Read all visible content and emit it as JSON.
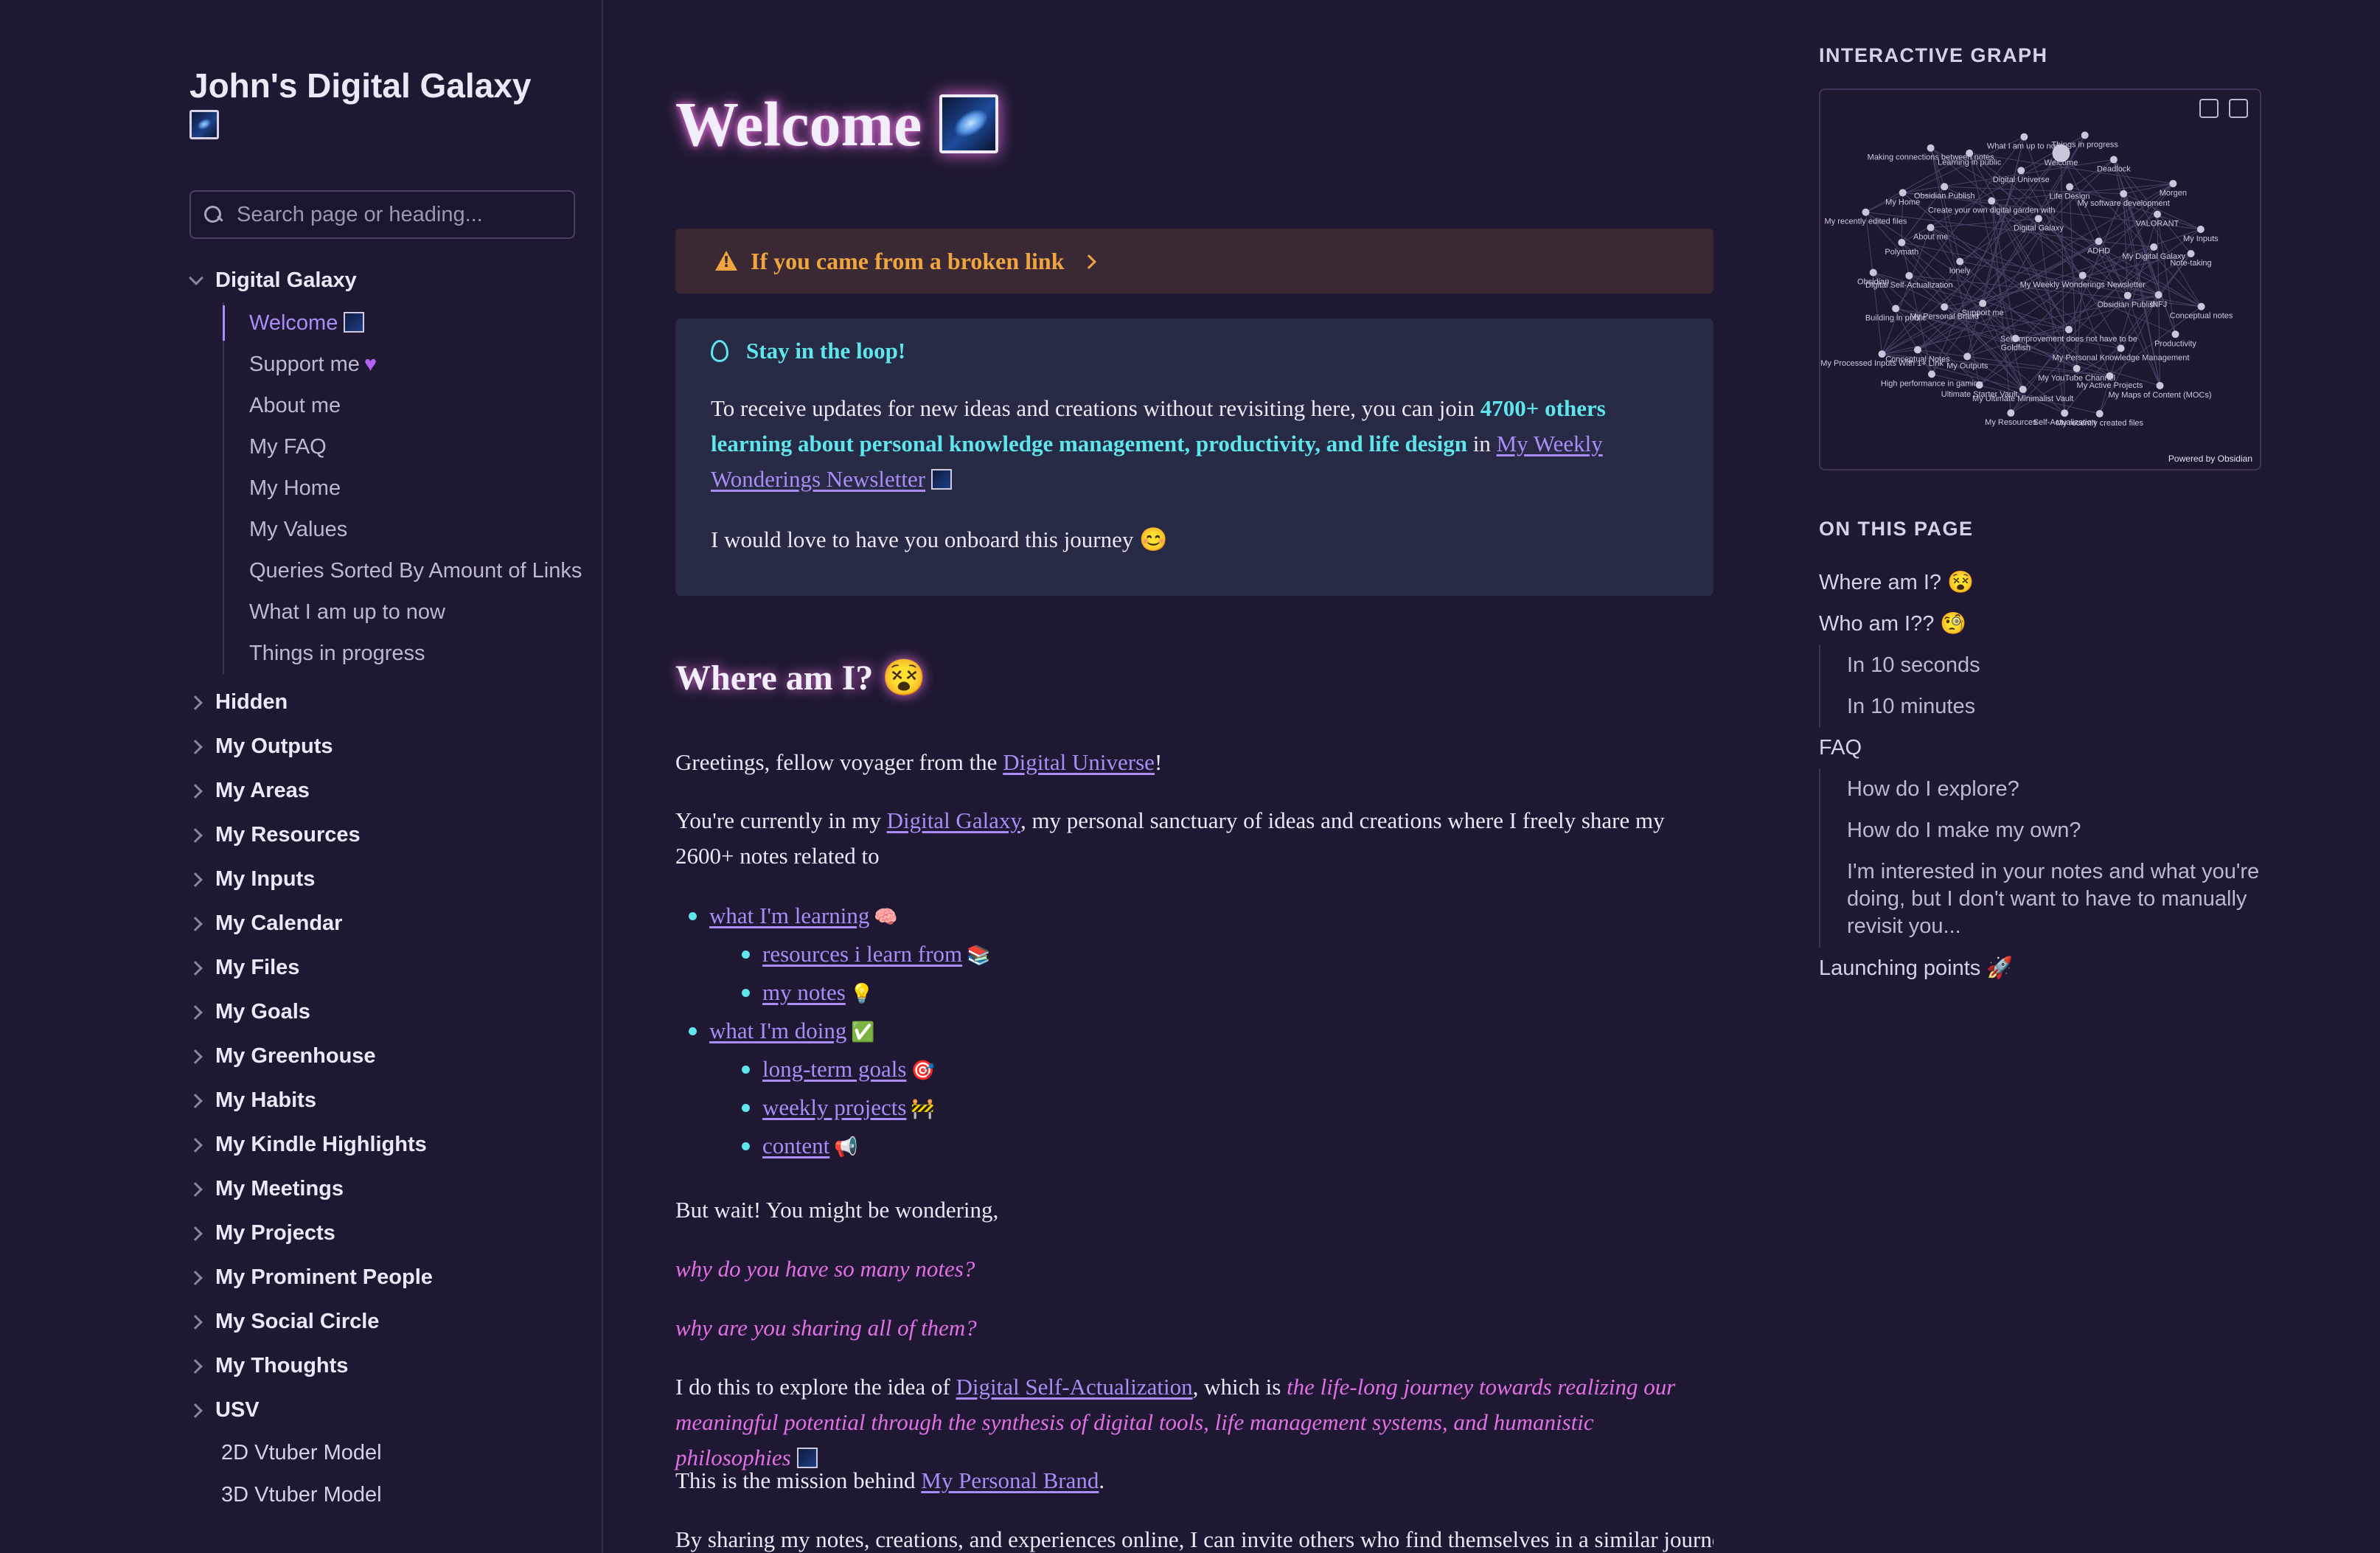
{
  "site": {
    "title": "John's Digital Galaxy",
    "search_placeholder": "Search page or heading..."
  },
  "nav": {
    "open_group": "Digital Galaxy",
    "children": [
      "Welcome",
      "Support me",
      "About me",
      "My FAQ",
      "My Home",
      "My Values",
      "Queries Sorted By Amount of Links",
      "What I am up to now",
      "Things in progress"
    ],
    "groups": [
      "Hidden",
      "My Outputs",
      "My Areas",
      "My Resources",
      "My Inputs",
      "My Calendar",
      "My Files",
      "My Goals",
      "My Greenhouse",
      "My Habits",
      "My Kindle Highlights",
      "My Meetings",
      "My Projects",
      "My Prominent People",
      "My Social Circle",
      "My Thoughts",
      "USV"
    ],
    "leaves": [
      "2D Vtuber Model",
      "3D Vtuber Model"
    ]
  },
  "main": {
    "title": "Welcome",
    "broken_link": "If you came from a broken link",
    "callout_title": "Stay in the loop!",
    "callout_p1_a": "To receive updates for new ideas and creations without revisiting here, you can join ",
    "callout_p1_b": "4700+ others learning about personal knowledge management, productivity, and life design",
    "callout_p1_c": " in ",
    "callout_p1_link": "My Weekly Wonderings Newsletter",
    "callout_p2": "I would love to have you onboard this journey 😊",
    "h2": "Where am I? 😵",
    "p1_a": "Greetings, fellow voyager from the ",
    "p1_link": "Digital Universe",
    "p1_b": "!",
    "p2_a": "You're currently in my ",
    "p2_link": "Digital Galaxy",
    "p2_b": ", my personal sanctuary of ideas and creations where I freely share my 2600+ notes related to",
    "bullets": [
      {
        "text": "what I'm learning",
        "emoji": "🧠",
        "sub": false
      },
      {
        "text": "resources i learn from",
        "emoji": "📚",
        "sub": true
      },
      {
        "text": "my notes",
        "emoji": "💡",
        "sub": true
      },
      {
        "text": "what I'm doing",
        "emoji": "✅",
        "sub": false
      },
      {
        "text": "long-term goals",
        "emoji": "🎯",
        "sub": true
      },
      {
        "text": "weekly projects",
        "emoji": "🚧",
        "sub": true
      },
      {
        "text": "content",
        "emoji": "📢",
        "sub": true
      }
    ],
    "p3": "But wait! You might be wondering,",
    "q1": "why do you have so many notes?",
    "q2": "why are you sharing all of them?",
    "p4_a": "I do this to explore the idea of ",
    "p4_link": "Digital Self-Actualization",
    "p4_b": ", which is ",
    "p4_italic": "the life-long journey towards realizing our meaningful potential through the synthesis of digital tools, life management systems, and humanistic philosophies",
    "p5_a": "This is the mission behind ",
    "p5_link": "My Personal Brand",
    "p5_b": ".",
    "p6": "By sharing my notes, creations, and experiences online, I can invite others who find themselves in a similar journey"
  },
  "right": {
    "graph_label": "INTERACTIVE GRAPH",
    "graph_nodes": [
      "My Weekly Wonderings Newsletter",
      "Support me",
      "Digital Galaxy",
      "Self-improvement does not have to be",
      "lonely",
      "ADHD",
      "Goldfish",
      "Create your own digital garden with",
      "Obsidian Publish",
      "My Personal Brand",
      "Life Design",
      "My YouTube Channel",
      "About me",
      "My Digital Galaxy",
      "My Outputs",
      "Digital Universe",
      "My Personal Knowledge Management",
      "Digital Self-Actualization",
      "My software development",
      "My Ultimate Minimalist Vault",
      "Obsidian Publish",
      "INFJ",
      "Conceptual Notes",
      "Welcome",
      "My Active Projects",
      "Polymath",
      "VALORANT",
      "Ultimate Starter Vault",
      "Learning in public",
      "Productivity",
      "Building in public",
      "Deadlock",
      "Self-Actualization",
      "My Home",
      "Note-taking",
      "High performance in gaming",
      "What I am up to now",
      "My Maps of Content (MOCs)",
      "Obsidian",
      "Morgen",
      "My Resources",
      "Making connections between notes",
      "Conceptual notes",
      "My Processed Inputs With 1+ Link",
      "Things in progress",
      "My recently created files",
      "My recently edited files",
      "My Inputs",
      "Powered by Obsidian"
    ],
    "toc_label": "ON THIS PAGE",
    "toc": {
      "where": "Where am I? 😵",
      "who": "Who am I?? 🧐",
      "who_children": [
        "In 10 seconds",
        "In 10 minutes"
      ],
      "faq": "FAQ",
      "faq_children": [
        "How do I explore?",
        "How do I make my own?",
        "I'm interested in your notes and what you're doing, but I don't want to have to manually revisit you..."
      ],
      "launch": "Launching points 🚀"
    }
  },
  "colors": {
    "background": "#1f1832",
    "accent": "#a98cf5",
    "cyan": "#5fe5ec",
    "warning": "#f0a53e",
    "pink": "#e36fe6"
  }
}
